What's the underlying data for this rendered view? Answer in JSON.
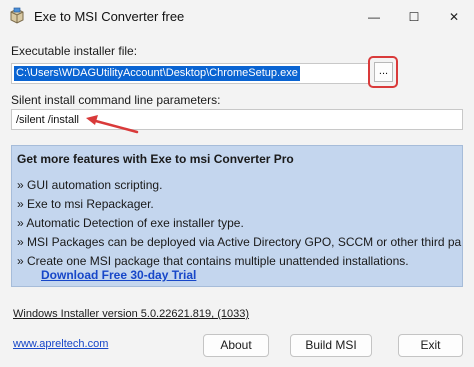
{
  "window": {
    "title": "Exe to MSI Converter free",
    "icon": "app-box-icon",
    "controls": {
      "minimize": "—",
      "maximize": "☐",
      "close": "✕"
    }
  },
  "installer_file": {
    "label": "Executable installer file:",
    "value": "C:\\Users\\WDAGUtilityAccount\\Desktop\\ChromeSetup.exe",
    "browse_label": "..."
  },
  "params": {
    "label": "Silent install command line parameters:",
    "value": "/silent /install"
  },
  "promo": {
    "title": "Get more features with Exe to msi Converter Pro",
    "items": [
      "» GUI automation scripting.",
      "» Exe to msi Repackager.",
      "» Automatic Detection of exe installer type.",
      "» MSI Packages can be deployed via Active Directory GPO, SCCM or other third party to",
      "» Create one MSI package that contains multiple unattended installations."
    ],
    "link": "Download Free 30-day Trial"
  },
  "footer": {
    "version": "Windows Installer version 5.0.22621.819, (1033)",
    "site": "www.apreltech.com",
    "about": "About",
    "build": "Build MSI",
    "exit": "Exit"
  },
  "annotation": {
    "color": "#d93a3a"
  }
}
